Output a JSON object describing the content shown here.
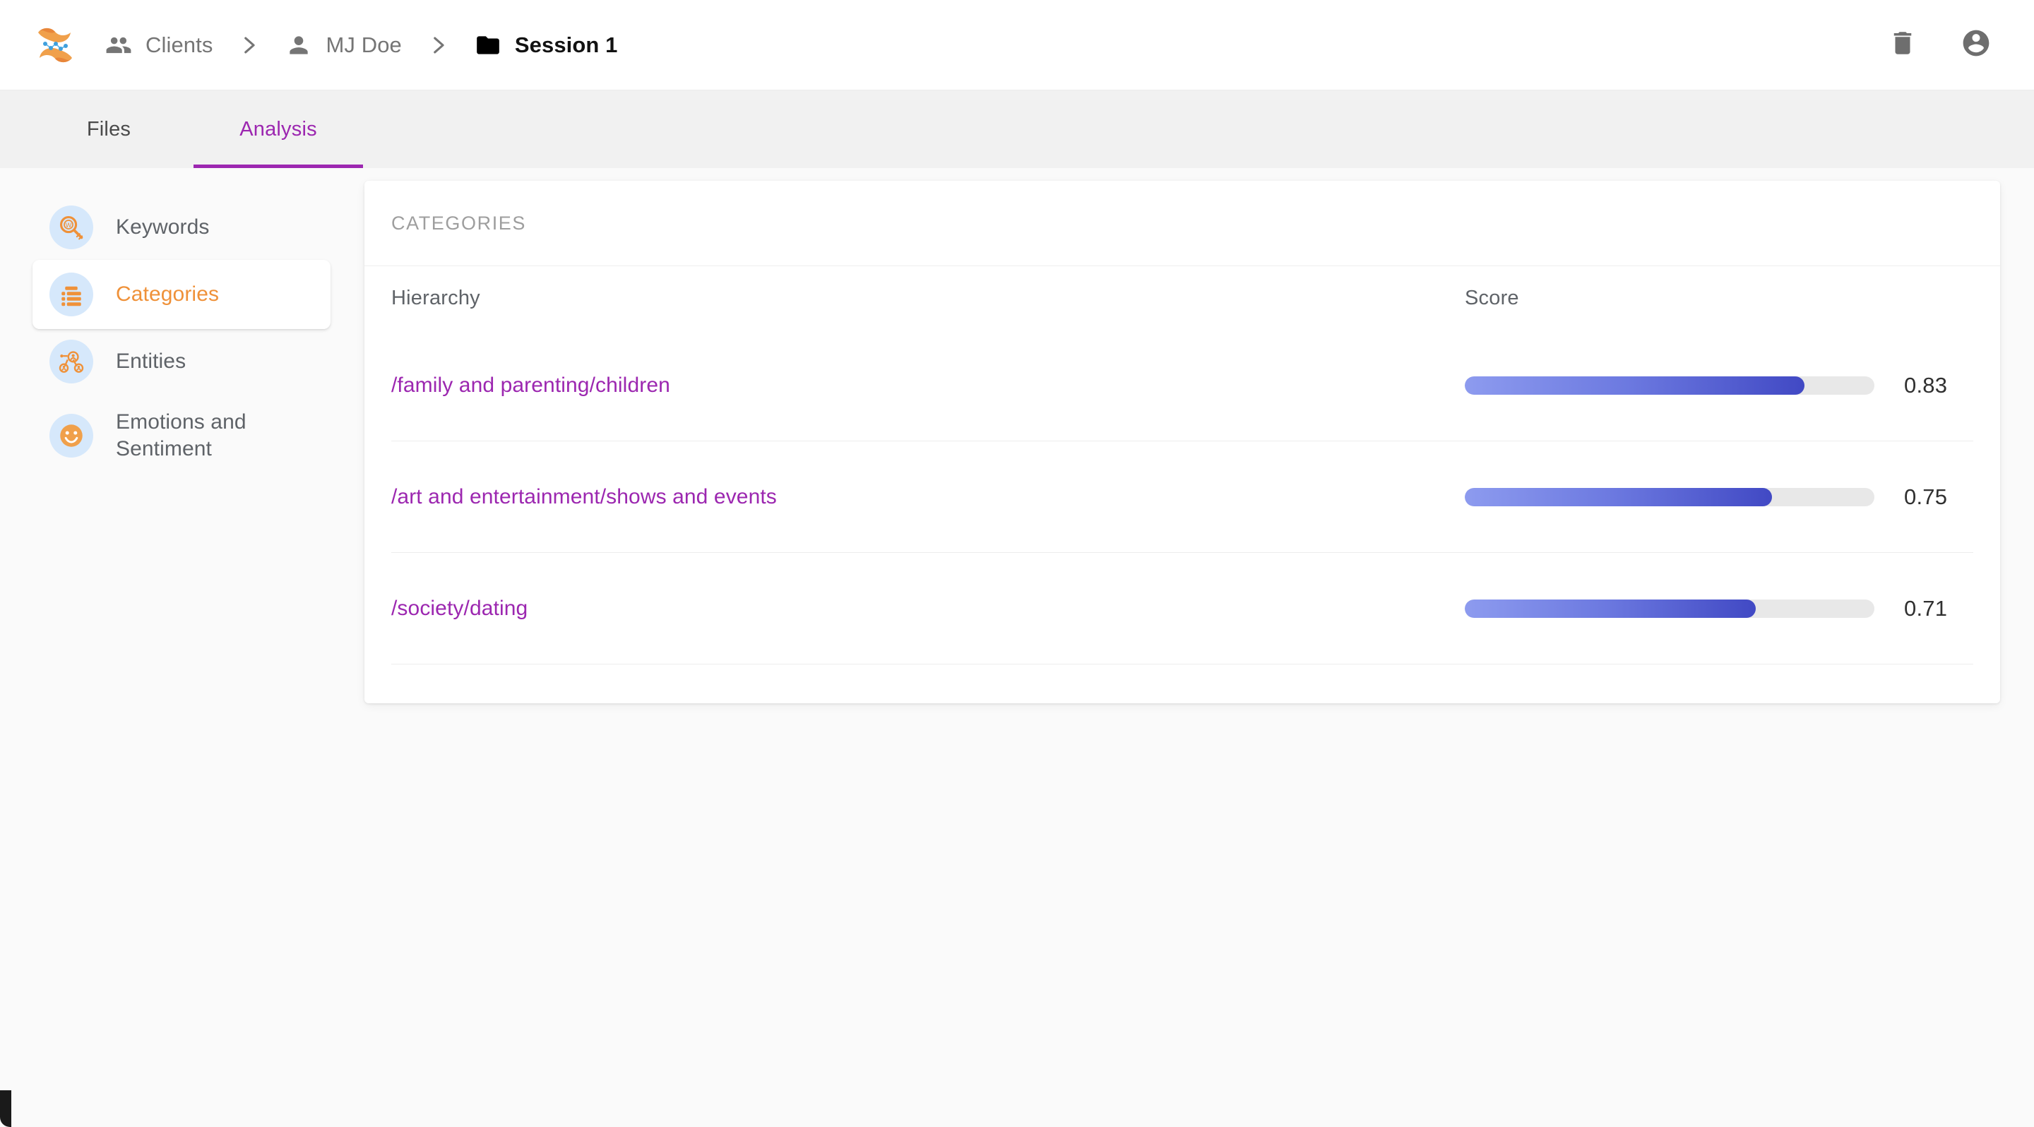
{
  "topbar": {
    "logo_name": "app-logo",
    "breadcrumbs": [
      {
        "label": "Clients",
        "icon": "people-icon",
        "current": false
      },
      {
        "label": "MJ Doe",
        "icon": "person-icon",
        "current": false
      },
      {
        "label": "Session 1",
        "icon": "folder-icon",
        "current": true
      }
    ],
    "separator": "›",
    "actions": [
      {
        "name": "delete-button",
        "icon": "trash-icon",
        "label": "Delete"
      },
      {
        "name": "account-button",
        "icon": "account-circle-icon",
        "label": "Account"
      }
    ]
  },
  "tabs": [
    {
      "label": "Files",
      "active": false
    },
    {
      "label": "Analysis",
      "active": true
    }
  ],
  "sidebar": {
    "items": [
      {
        "label": "Keywords",
        "icon": "keyword-search-icon",
        "selected": false
      },
      {
        "label": "Categories",
        "icon": "categories-list-icon",
        "selected": true
      },
      {
        "label": "Entities",
        "icon": "entities-network-icon",
        "selected": false
      },
      {
        "label": "Emotions and Sentiment",
        "icon": "emotion-smiley-icon",
        "selected": false
      }
    ]
  },
  "card": {
    "title": "CATEGORIES",
    "columns": [
      "Hierarchy",
      "Score"
    ],
    "rows": [
      {
        "hierarchy": "/family and parenting/children",
        "score": "0.83",
        "score_value": 0.83
      },
      {
        "hierarchy": "/art and entertainment/shows and events",
        "score": "0.75",
        "score_value": 0.75
      },
      {
        "hierarchy": "/society/dating",
        "score": "0.71",
        "score_value": 0.71
      }
    ]
  },
  "colors": {
    "accent_purple": "#9c27b0",
    "accent_orange": "#ef9139",
    "bar_start": "#8d9bef",
    "bar_end": "#4149c4",
    "bar_track": "#e8e8e8",
    "icon_bubble": "#d6e8fb",
    "page_bg": "#fafafa",
    "tabbar_bg": "#f1f1f1"
  }
}
